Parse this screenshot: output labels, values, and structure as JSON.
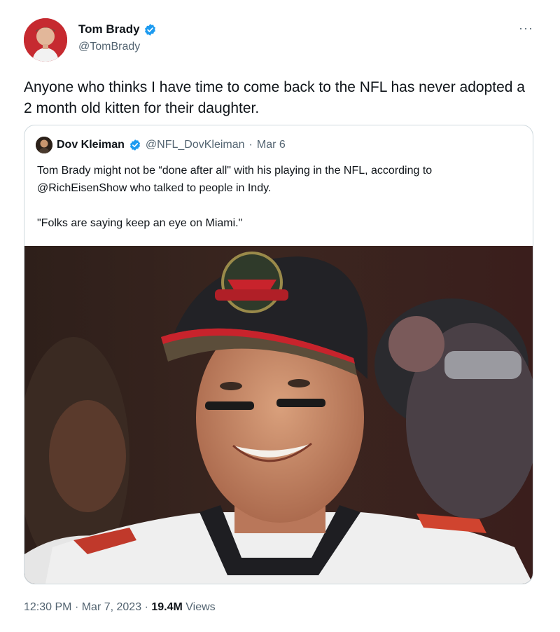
{
  "tweet": {
    "author_name": "Tom Brady",
    "author_handle": "@TomBrady",
    "more_label": "···",
    "text": "Anyone who thinks I have time to come back to the NFL has never adopted a 2 month old kitten for their daughter.",
    "time": "12:30 PM",
    "date": "Mar 7, 2023",
    "views_count": "19.4M",
    "views_label": "Views",
    "separator": "·"
  },
  "quoted": {
    "author_name": "Dov Kleiman",
    "author_handle": "@NFL_DovKleiman",
    "date": "Mar 6",
    "separator": "·",
    "text_line1": "Tom Brady might not be “done after all\" with his playing in the NFL, according to @RichEisenShow who talked to people in Indy.",
    "text_line2": "\"Folks are saying keep an eye on Miami.\""
  },
  "colors": {
    "verified_badge": "#1d9bf0",
    "text_primary": "#0f1419",
    "text_secondary": "#536471",
    "border": "#cfd9de"
  }
}
